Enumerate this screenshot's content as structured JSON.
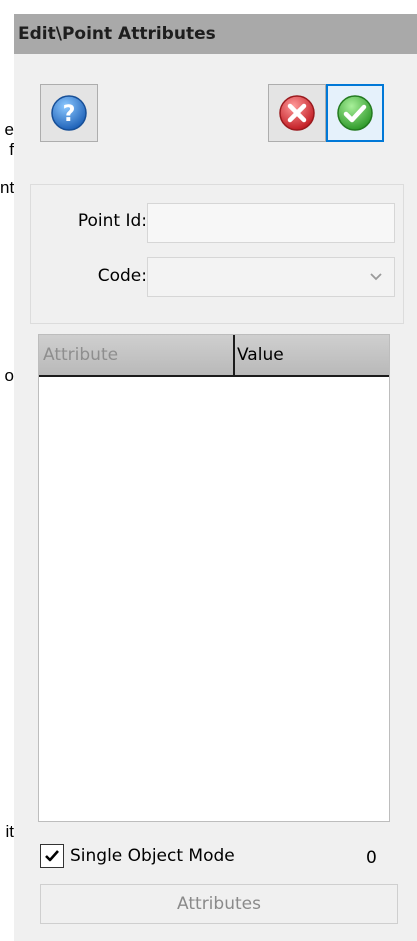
{
  "background_text": [
    "e",
    "f",
    "nt",
    "o",
    "it"
  ],
  "window": {
    "title": "Edit\\Point Attributes"
  },
  "toolbar": {
    "help_icon": "help-icon",
    "cancel_icon": "cancel-icon",
    "ok_icon": "ok-icon",
    "colors": {
      "help": "#2f7fd0",
      "cancel": "#d6333a",
      "ok": "#3fae3a",
      "focus": "#0078d7"
    }
  },
  "form": {
    "point_id_label": "Point Id:",
    "point_id_value": "",
    "code_label": "Code:",
    "code_value": ""
  },
  "grid": {
    "columns": [
      "Attribute",
      "Value"
    ],
    "rows": []
  },
  "footer": {
    "single_object_mode_label": "Single Object Mode",
    "single_object_mode_checked": true,
    "count": "0",
    "attributes_button_label": "Attributes"
  }
}
